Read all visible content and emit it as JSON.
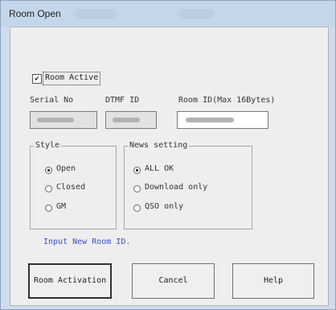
{
  "window": {
    "title": "Room Open",
    "blur_tab_1": "",
    "blur_tab_2": ""
  },
  "room_active": {
    "label": "Room Active",
    "checked": true
  },
  "fields": {
    "serial_no": {
      "label": "Serial No",
      "value": ""
    },
    "dtmf_id": {
      "label": "DTMF ID",
      "value": ""
    },
    "room_id": {
      "label": "Room ID(Max 16Bytes)",
      "value": ""
    }
  },
  "style_group": {
    "legend": "Style",
    "options": [
      {
        "label": "Open",
        "selected": true
      },
      {
        "label": "Closed",
        "selected": false
      },
      {
        "label": "GM",
        "selected": false
      }
    ]
  },
  "news_group": {
    "legend": "News setting",
    "options": [
      {
        "label": "ALL OK",
        "selected": true
      },
      {
        "label": "Download only",
        "selected": false
      },
      {
        "label": "QSO only",
        "selected": false
      }
    ]
  },
  "status_message": "Input New Room ID.",
  "colors": {
    "status_text": "#3a4fc2",
    "title_bar": "#c5d6ea"
  },
  "buttons": {
    "room_activation": "Room Activation",
    "cancel": "Cancel",
    "help": "Help"
  }
}
